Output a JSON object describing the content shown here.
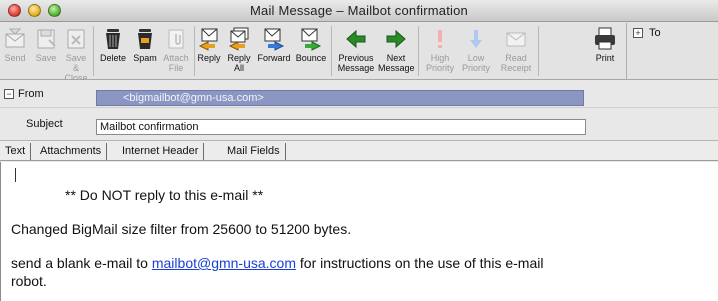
{
  "window": {
    "title": "Mail Message – Mailbot confirmation"
  },
  "toolbar": {
    "buttons": [
      {
        "label": "Send",
        "icon": "send-icon",
        "enabled": false
      },
      {
        "label": "Save",
        "icon": "save-icon",
        "enabled": false
      },
      {
        "label": "Save &\nClose",
        "icon": "save-close-icon",
        "enabled": false
      },
      {
        "label": "Delete",
        "icon": "trash-icon",
        "enabled": true
      },
      {
        "label": "Spam",
        "icon": "spam-trash-icon",
        "enabled": true
      },
      {
        "label": "Attach\nFile",
        "icon": "attach-icon",
        "enabled": false
      },
      {
        "label": "Reply",
        "icon": "reply-icon",
        "enabled": true
      },
      {
        "label": "Reply\nAll",
        "icon": "reply-all-icon",
        "enabled": true
      },
      {
        "label": "Forward",
        "icon": "forward-icon",
        "enabled": true
      },
      {
        "label": "Bounce",
        "icon": "bounce-icon",
        "enabled": true
      },
      {
        "label": "Previous\nMessage",
        "icon": "arrow-left-icon",
        "enabled": true
      },
      {
        "label": "Next\nMessage",
        "icon": "arrow-right-icon",
        "enabled": true
      },
      {
        "label": "High\nPriority",
        "icon": "high-priority-icon",
        "enabled": false
      },
      {
        "label": "Low\nPriority",
        "icon": "low-priority-icon",
        "enabled": false
      },
      {
        "label": "Read\nReceipt",
        "icon": "read-receipt-icon",
        "enabled": false
      },
      {
        "label": "Print",
        "icon": "printer-icon",
        "enabled": true
      }
    ],
    "to_label": "To"
  },
  "header": {
    "from_label": "From",
    "from_value": "<bigmailbot@gmn-usa.com>",
    "subject_label": "Subject",
    "subject_value": "Mailbot confirmation"
  },
  "tabs": [
    "Text",
    "Attachments",
    "Internet Header",
    "Mail Fields"
  ],
  "message": {
    "line1": "** Do NOT reply to this e-mail **",
    "line2": "Changed BigMail size filter from 25600 to 51200 bytes.",
    "line3_before": "send a blank e-mail to ",
    "line3_link": "mailbot@gmn-usa.com",
    "line3_after": " for instructions on the use of this e-mail",
    "line4": "robot."
  },
  "colors": {
    "from_field_bg": "#8b97c2",
    "link": "#1a3fd6"
  }
}
